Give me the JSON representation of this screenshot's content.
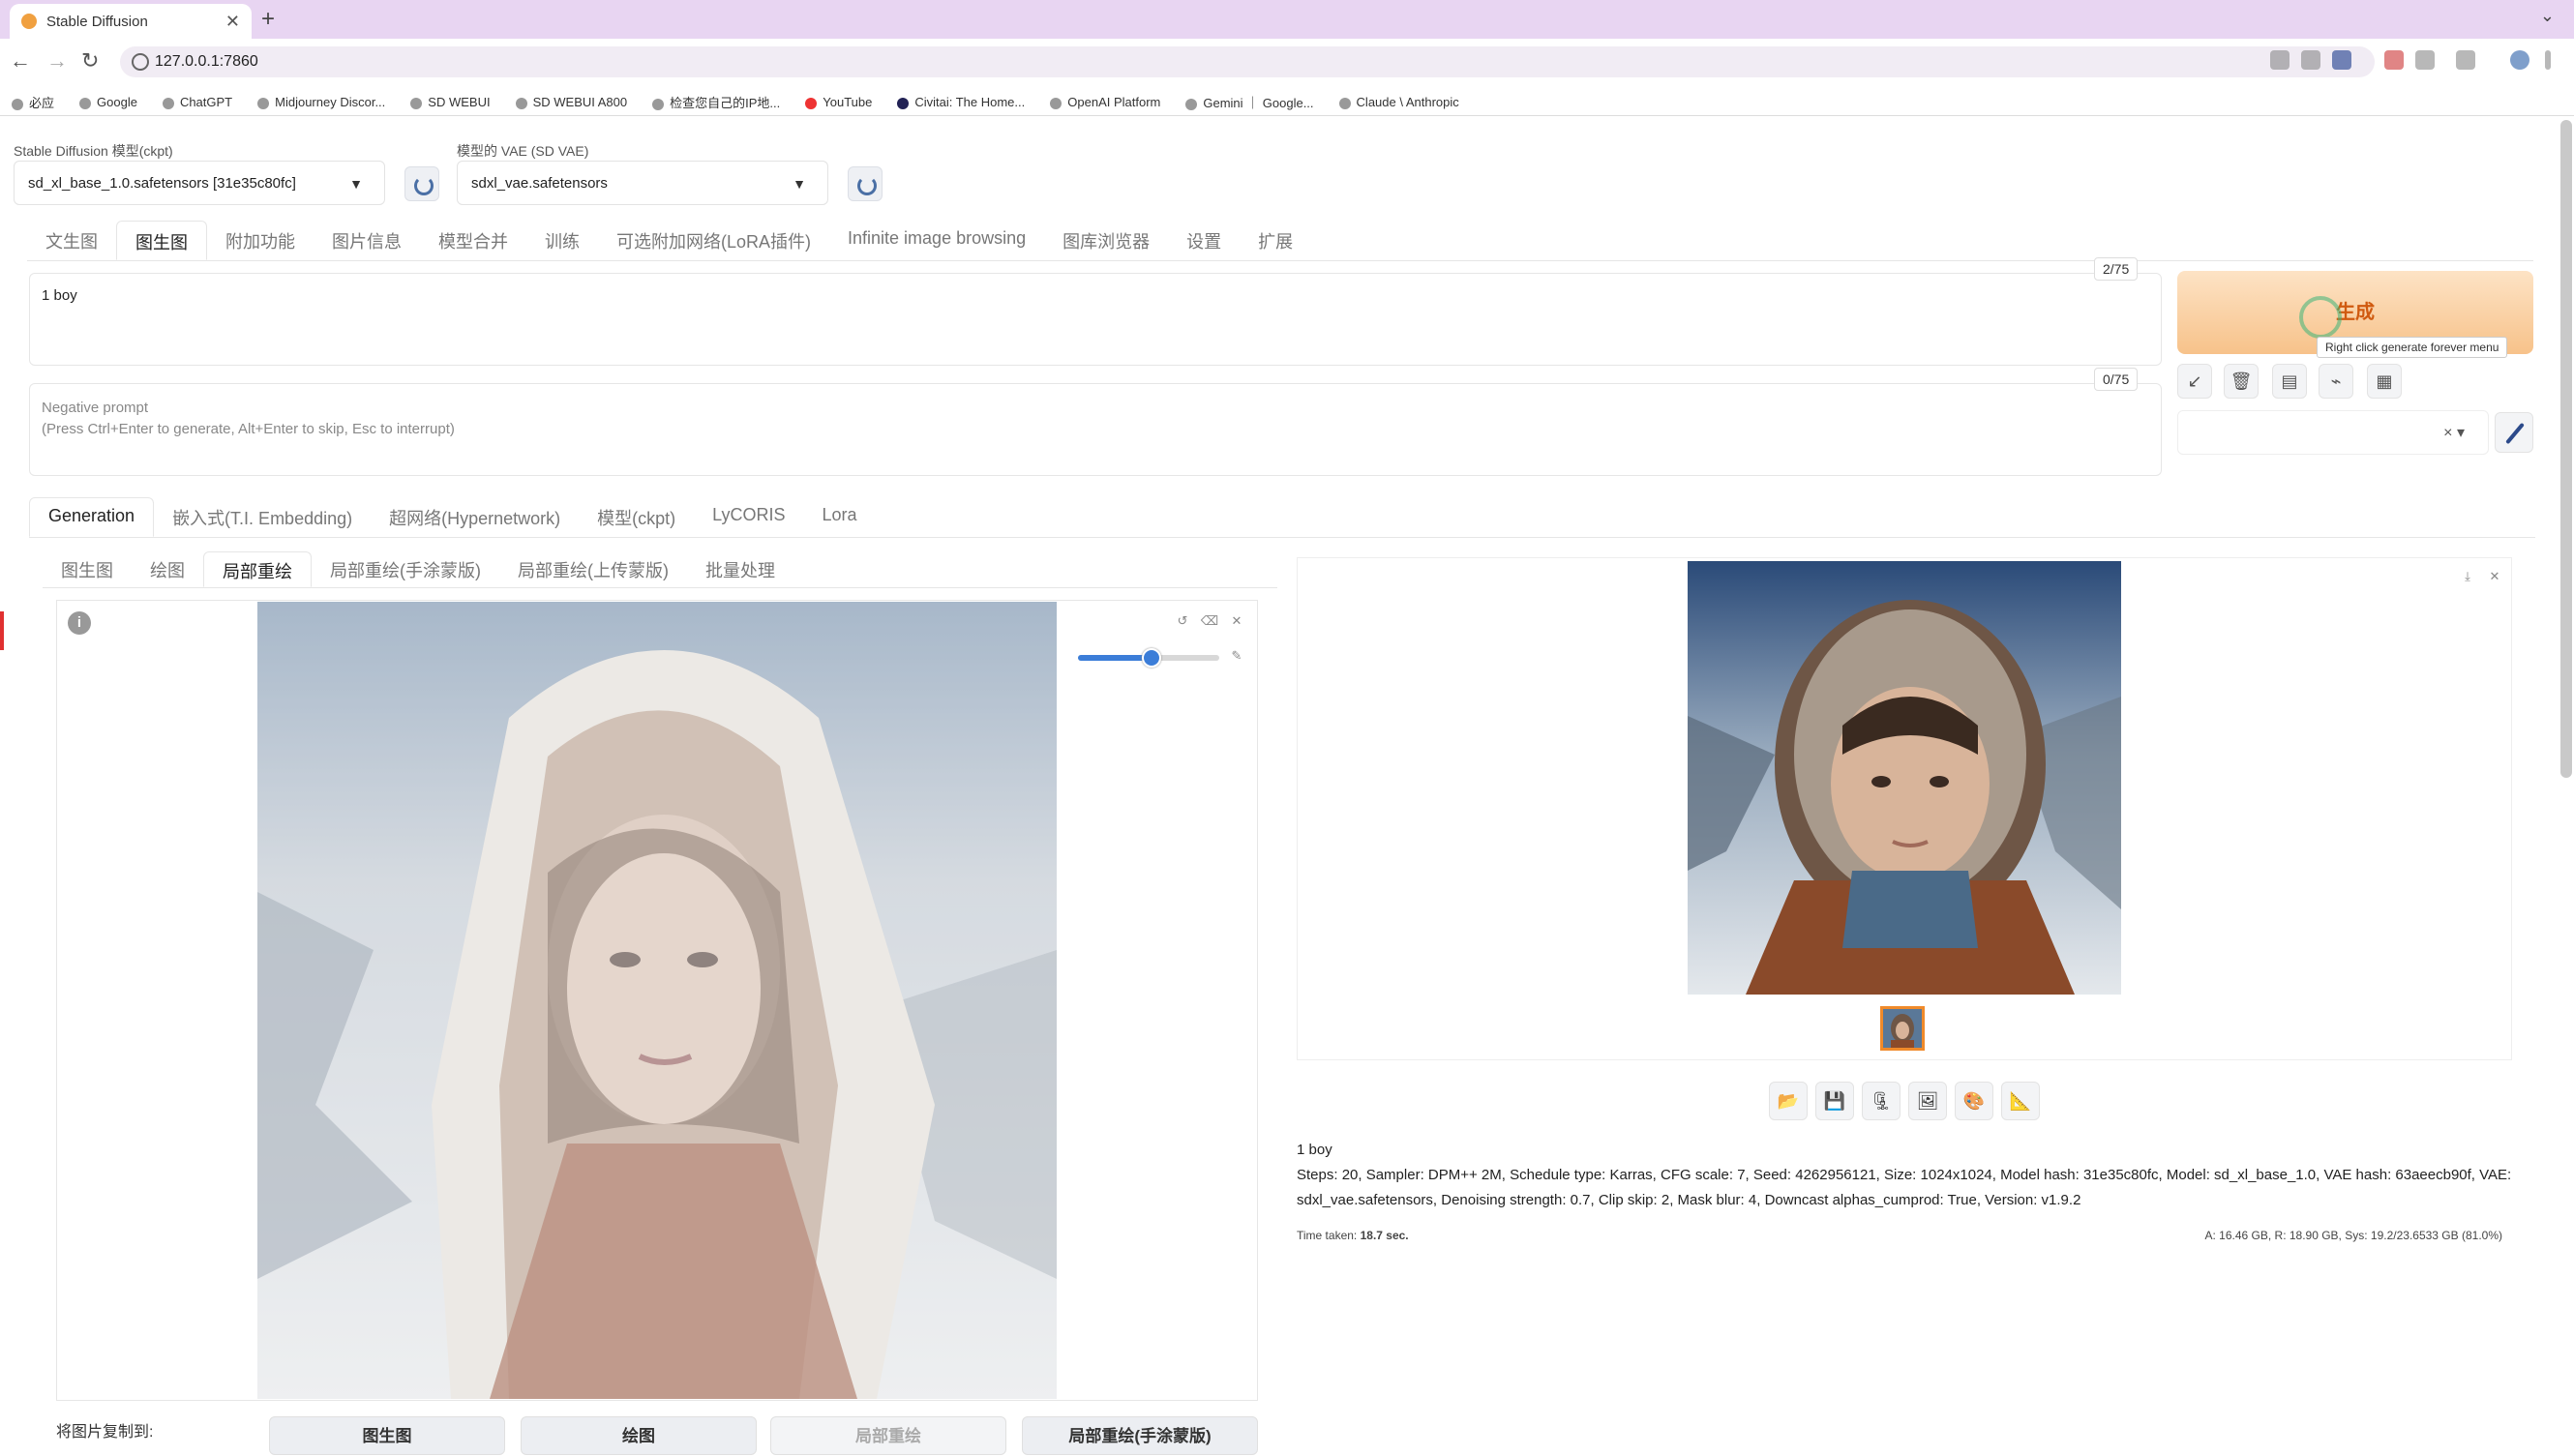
{
  "browser": {
    "tab_title": "Stable Diffusion",
    "new_tab": "+",
    "close": "✕",
    "url": "127.0.0.1:7860",
    "bookmarks": [
      "必应",
      "Google",
      "ChatGPT",
      "Midjourney Discor...",
      "SD WEBUI",
      "SD WEBUI A800",
      "检查您自己的IP地...",
      "YouTube",
      "Civitai: The Home...",
      "OpenAI Platform",
      "Gemini ｜ Google...",
      "Claude \\ Anthropic"
    ]
  },
  "model": {
    "ckpt_label": "Stable Diffusion 模型(ckpt)",
    "ckpt_value": "sd_xl_base_1.0.safetensors [31e35c80fc]",
    "vae_label": "模型的 VAE (SD VAE)",
    "vae_value": "sdxl_vae.safetensors"
  },
  "main_tabs": [
    "文生图",
    "图生图",
    "附加功能",
    "图片信息",
    "模型合并",
    "训练",
    "可选附加网络(LoRA插件)",
    "Infinite image browsing",
    "图库浏览器",
    "设置",
    "扩展"
  ],
  "prompt": {
    "value": "1 boy",
    "counter": "2/75",
    "negative_placeholder_1": "Negative prompt",
    "negative_placeholder_2": "(Press Ctrl+Enter to generate, Alt+Enter to skip, Esc to interrupt)",
    "negative_counter": "0/75"
  },
  "generate": {
    "label": "生成",
    "tooltip": "Right click generate forever menu"
  },
  "style_clear": "× ▾",
  "sub_tabs": [
    "Generation",
    "嵌入式(T.I. Embedding)",
    "超网络(Hypernetwork)",
    "模型(ckpt)",
    "LyCORIS",
    "Lora"
  ],
  "inner_tabs": [
    "图生图",
    "绘图",
    "局部重绘",
    "局部重绘(手涂蒙版)",
    "局部重绘(上传蒙版)",
    "批量处理"
  ],
  "brush_slider_value": 0.52,
  "output": {
    "prompt": "1 boy",
    "params_line1": "Steps: 20, Sampler: DPM++ 2M, Schedule type: Karras, CFG scale: 7, Seed: 4262956121, Size: 1024x1024, Model hash: 31e35c80fc, Model: sd_xl_base_1.0, VAE hash: 63aeecb90f, VAE:",
    "params_line2": "sdxl_vae.safetensors, Denoising strength: 0.7, Clip skip: 2, Mask blur: 4, Downcast alphas_cumprod: True, Version: v1.9.2",
    "time_label": "Time taken:",
    "time_value": "18.7 sec.",
    "mem": "A: 16.46 GB, R: 18.90 GB, Sys: 19.2/23.6533 GB (81.0%)"
  },
  "copy_to": {
    "label": "将图片复制到:",
    "buttons": [
      "图生图",
      "绘图",
      "局部重绘",
      "局部重绘(手涂蒙版)"
    ]
  },
  "colors": {
    "generate_text": "#d05a10",
    "tab_bar": "#e8d5f2",
    "accent": "#3b7dd8"
  }
}
